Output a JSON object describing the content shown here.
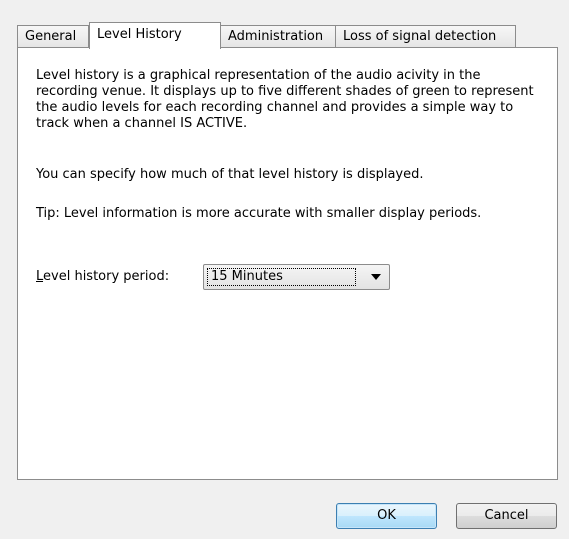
{
  "tabs": [
    {
      "label": "General",
      "active": false
    },
    {
      "label": "Level History",
      "active": true
    },
    {
      "label": "Administration",
      "active": false
    },
    {
      "label": "Loss of signal detection",
      "active": false
    }
  ],
  "panel": {
    "description": "Level history is a graphical representation of the audio acivity in the recording venue.  It displays up to five different shades of green to represent the audio levels for each recording channel and provides a simple way to track when a channel IS ACTIVE.",
    "specify_text": "You can specify how much of that level history is displayed.",
    "tip_text": "Tip: Level information is more accurate with smaller display periods.",
    "period_label_accel": "L",
    "period_label_rest": "evel history period:",
    "period_value": "15 Minutes"
  },
  "buttons": {
    "ok": "OK",
    "cancel": "Cancel"
  },
  "colors": {
    "ok_button_accent": "#bee6fd",
    "window_background": "#f0f0f0",
    "panel_background": "#ffffff"
  }
}
